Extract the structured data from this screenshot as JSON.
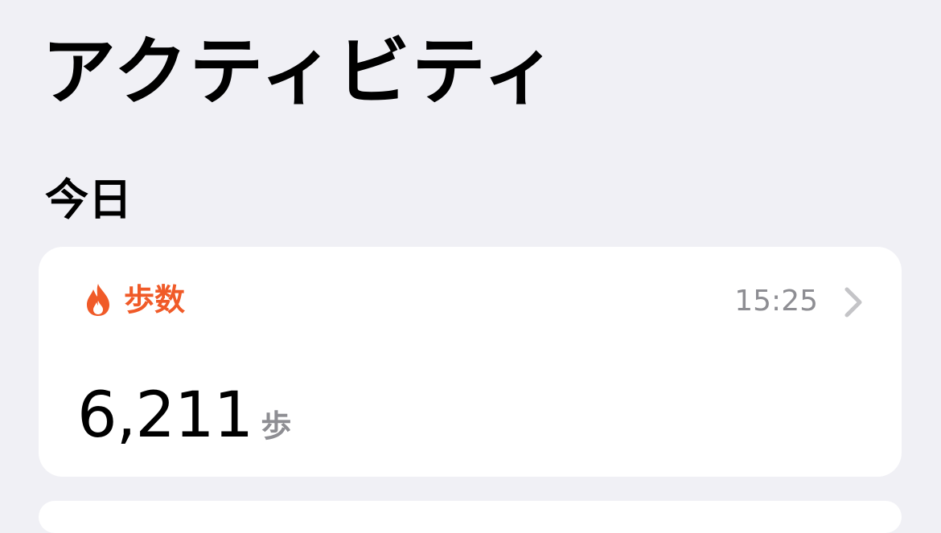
{
  "page": {
    "title": "アクティビティ",
    "section_title": "今日"
  },
  "colors": {
    "background": "#f0f0f5",
    "card": "#ffffff",
    "accent": "#f05a28",
    "secondary_text": "#8e8e93",
    "chevron": "#c4c4c7"
  },
  "steps_card": {
    "icon": "flame-icon",
    "label": "歩数",
    "time": "15:25",
    "value": "6,211",
    "unit": "歩"
  }
}
